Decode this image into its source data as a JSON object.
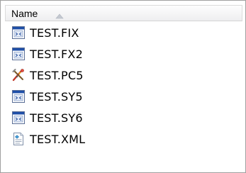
{
  "header": {
    "name_label": "Name",
    "sort_icon": "sort-ascending-arrow"
  },
  "files": [
    {
      "name": "TEST.FIX",
      "icon": "application-window-icon"
    },
    {
      "name": "TEST.FX2",
      "icon": "application-window-icon"
    },
    {
      "name": "TEST.PC5",
      "icon": "tools-settings-icon"
    },
    {
      "name": "TEST.SY5",
      "icon": "application-window-icon"
    },
    {
      "name": "TEST.SY6",
      "icon": "application-window-icon"
    },
    {
      "name": "TEST.XML",
      "icon": "xml-document-icon"
    }
  ],
  "colors": {
    "border": "#a0a0a0",
    "header_bg": "#f3f3f5",
    "window_blue": "#1f4fa8"
  }
}
